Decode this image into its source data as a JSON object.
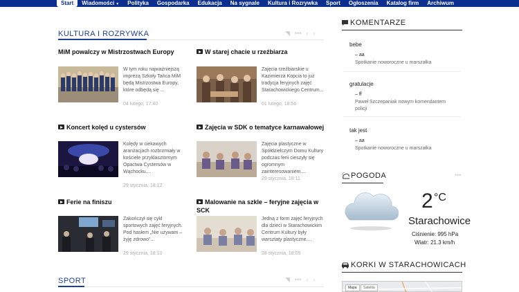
{
  "nav": {
    "items": [
      "Start",
      "Wiadomości",
      "Polityka",
      "Gospodarka",
      "Edukacja",
      "Na sygnale",
      "Kultura i Rozrywka",
      "Sport",
      "Ogłoszenia",
      "Katalog firm",
      "Archiwum"
    ]
  },
  "culture": {
    "title": "KULTURA I ROZRYWKA",
    "articles": [
      {
        "title": "MiM powalczy w Mistrzostwach Europy",
        "excerpt": "W tym roku najważniejszą imprezą Szkoły Tańca MiM będą Mistrzostwa Europy, które odbędą się ...",
        "date": "04 lutego, 17:40"
      },
      {
        "title": "W starej chacie u rzeźbiarza",
        "excerpt": "Zajęcia rzeźbiarskie u Kazimierza Kopcia to już tradycja feryjnych zajęć Starachowickiego Centrum...",
        "date": "01 lutego, 18:56"
      },
      {
        "title": "Koncert kolęd u cystersów",
        "excerpt": "Kolędy w ciekawych aranżacjach rozbrzmiały w kościele przyklasztornym Opactwa Cystersów w Wąchocku....",
        "date": "29 stycznia, 18:12"
      },
      {
        "title": "Zajęcia w SDK o tematyce karnawałowej",
        "excerpt": "Zajęcia plastyczne w Spółdzielczym Domu Kultury podczas ferii cieszyły się ogromnym zainteresowaniem....",
        "date": "29 stycznia, 18:11"
      },
      {
        "title": "Ferie na finiszu",
        "excerpt": "Zakończył się cykl sportowych zajęć feryjnych. Pod hasłem „Nie używam – żyję zdrowo\"...",
        "date": "29 stycznia, 18:10"
      },
      {
        "title": "Malowanie na szkle – feryjne zajęcia w SCK",
        "excerpt": "Jedną z form zajęć feryjnych dla dzieci w Starachowickim Centrum Kultury były warsztaty plastyczne....",
        "date": "28 stycznia, 18:05"
      }
    ]
  },
  "sport": {
    "title": "SPORT"
  },
  "comments": {
    "title": "KOMENTARZE",
    "items": [
      {
        "text": "bebe",
        "author": "aa",
        "post": "Spotkanie noworoczne u marszałka"
      },
      {
        "text": "gratulacje",
        "author": "ff",
        "post": "Paweł Szczepaniak nowym komendantem policji"
      },
      {
        "text": "tak jest",
        "author": "aa",
        "post": "Spotkanie noworoczne u marszałka"
      }
    ]
  },
  "weather": {
    "title": "POGODA",
    "temp": "2",
    "unit": "°C",
    "city": "Starachowice",
    "pressure": "Ciśnienie: 995 hPa",
    "wind": "Wiatr: 21.3 km/h"
  },
  "traffic": {
    "title": "KORKI W STARACHOWICACH",
    "map_tab": "Mapa",
    "sat_tab": "Satelita"
  }
}
